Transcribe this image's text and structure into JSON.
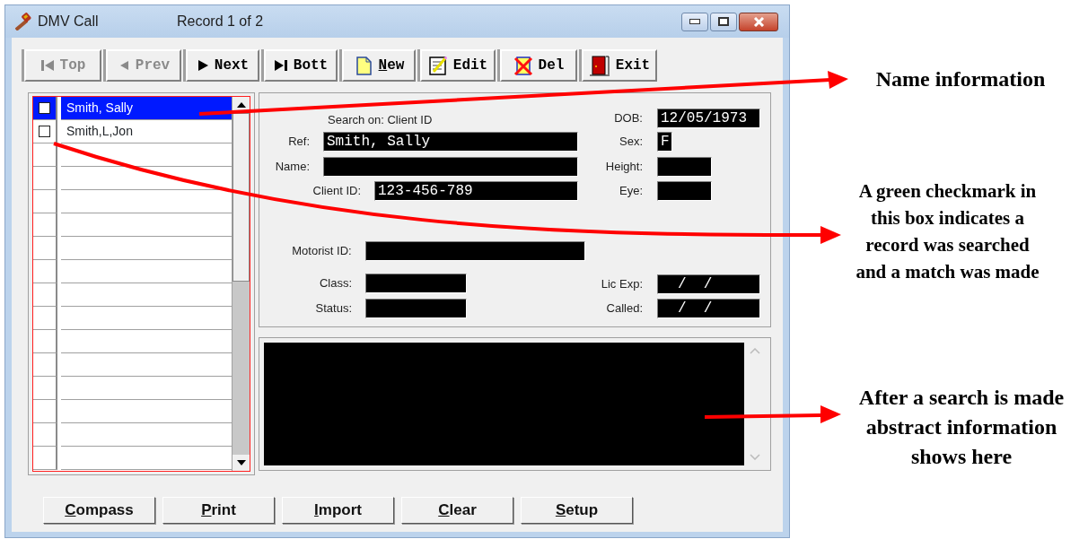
{
  "window": {
    "title": "DMV Call",
    "record": "Record 1 of 2"
  },
  "toolbar": [
    {
      "kind": "top",
      "label": "Top",
      "disabled": true,
      "underline_first": false
    },
    {
      "kind": "prev",
      "label": "Prev",
      "disabled": true,
      "underline_first": false
    },
    {
      "kind": "next",
      "label": "Next",
      "disabled": false,
      "underline_first": false
    },
    {
      "kind": "bott",
      "label": "Bott",
      "disabled": false,
      "underline_first": false
    },
    {
      "kind": "new",
      "label": "New",
      "disabled": false,
      "underline_first": true
    },
    {
      "kind": "edit",
      "label": "Edit",
      "disabled": false,
      "underline_first": false
    },
    {
      "kind": "del",
      "label": "Del",
      "disabled": false,
      "underline_first": false
    },
    {
      "kind": "exit",
      "label": "Exit",
      "disabled": false,
      "underline_first": false
    }
  ],
  "records": [
    {
      "name": "Smith, Sally",
      "selected": true,
      "checked": false
    },
    {
      "name": "Smith,L,Jon",
      "selected": false,
      "checked": false
    }
  ],
  "details": {
    "search_on": "Search on: Client ID",
    "left_fields": [
      {
        "label": "Ref:",
        "value": "Smith, Sally"
      },
      {
        "label": "Name:"
      },
      {
        "label": "Client ID:",
        "value": "123-456-789"
      },
      {
        "label": "Motorist ID:"
      },
      {
        "label": "Class:"
      },
      {
        "label": "Status:"
      }
    ],
    "right_fields": [
      {
        "label": "DOB:",
        "value": "12/05/1973"
      },
      {
        "label": "Sex:",
        "value": "F"
      },
      {
        "label": "Height:"
      },
      {
        "label": "Eye:"
      },
      {
        "label": "Lic Exp:",
        "value": "/  /"
      },
      {
        "label": "Called:",
        "value": "/  /"
      }
    ]
  },
  "buttons": [
    {
      "label": "Compass",
      "underline_first": true
    },
    {
      "label": "Print",
      "underline_first": true
    },
    {
      "label": "Import",
      "underline_first": true
    },
    {
      "label": "Clear",
      "underline_first": true
    },
    {
      "label": "Setup",
      "underline_first": true
    }
  ],
  "annotations": [
    {
      "kind": "name",
      "text": "Name information"
    },
    {
      "kind": "checkmark",
      "text": "A green checkmark in\nthis box indicates a\nrecord was searched\nand a match was made"
    },
    {
      "kind": "abstract",
      "text": "After a search is made\nabstract information\nshows here"
    }
  ]
}
